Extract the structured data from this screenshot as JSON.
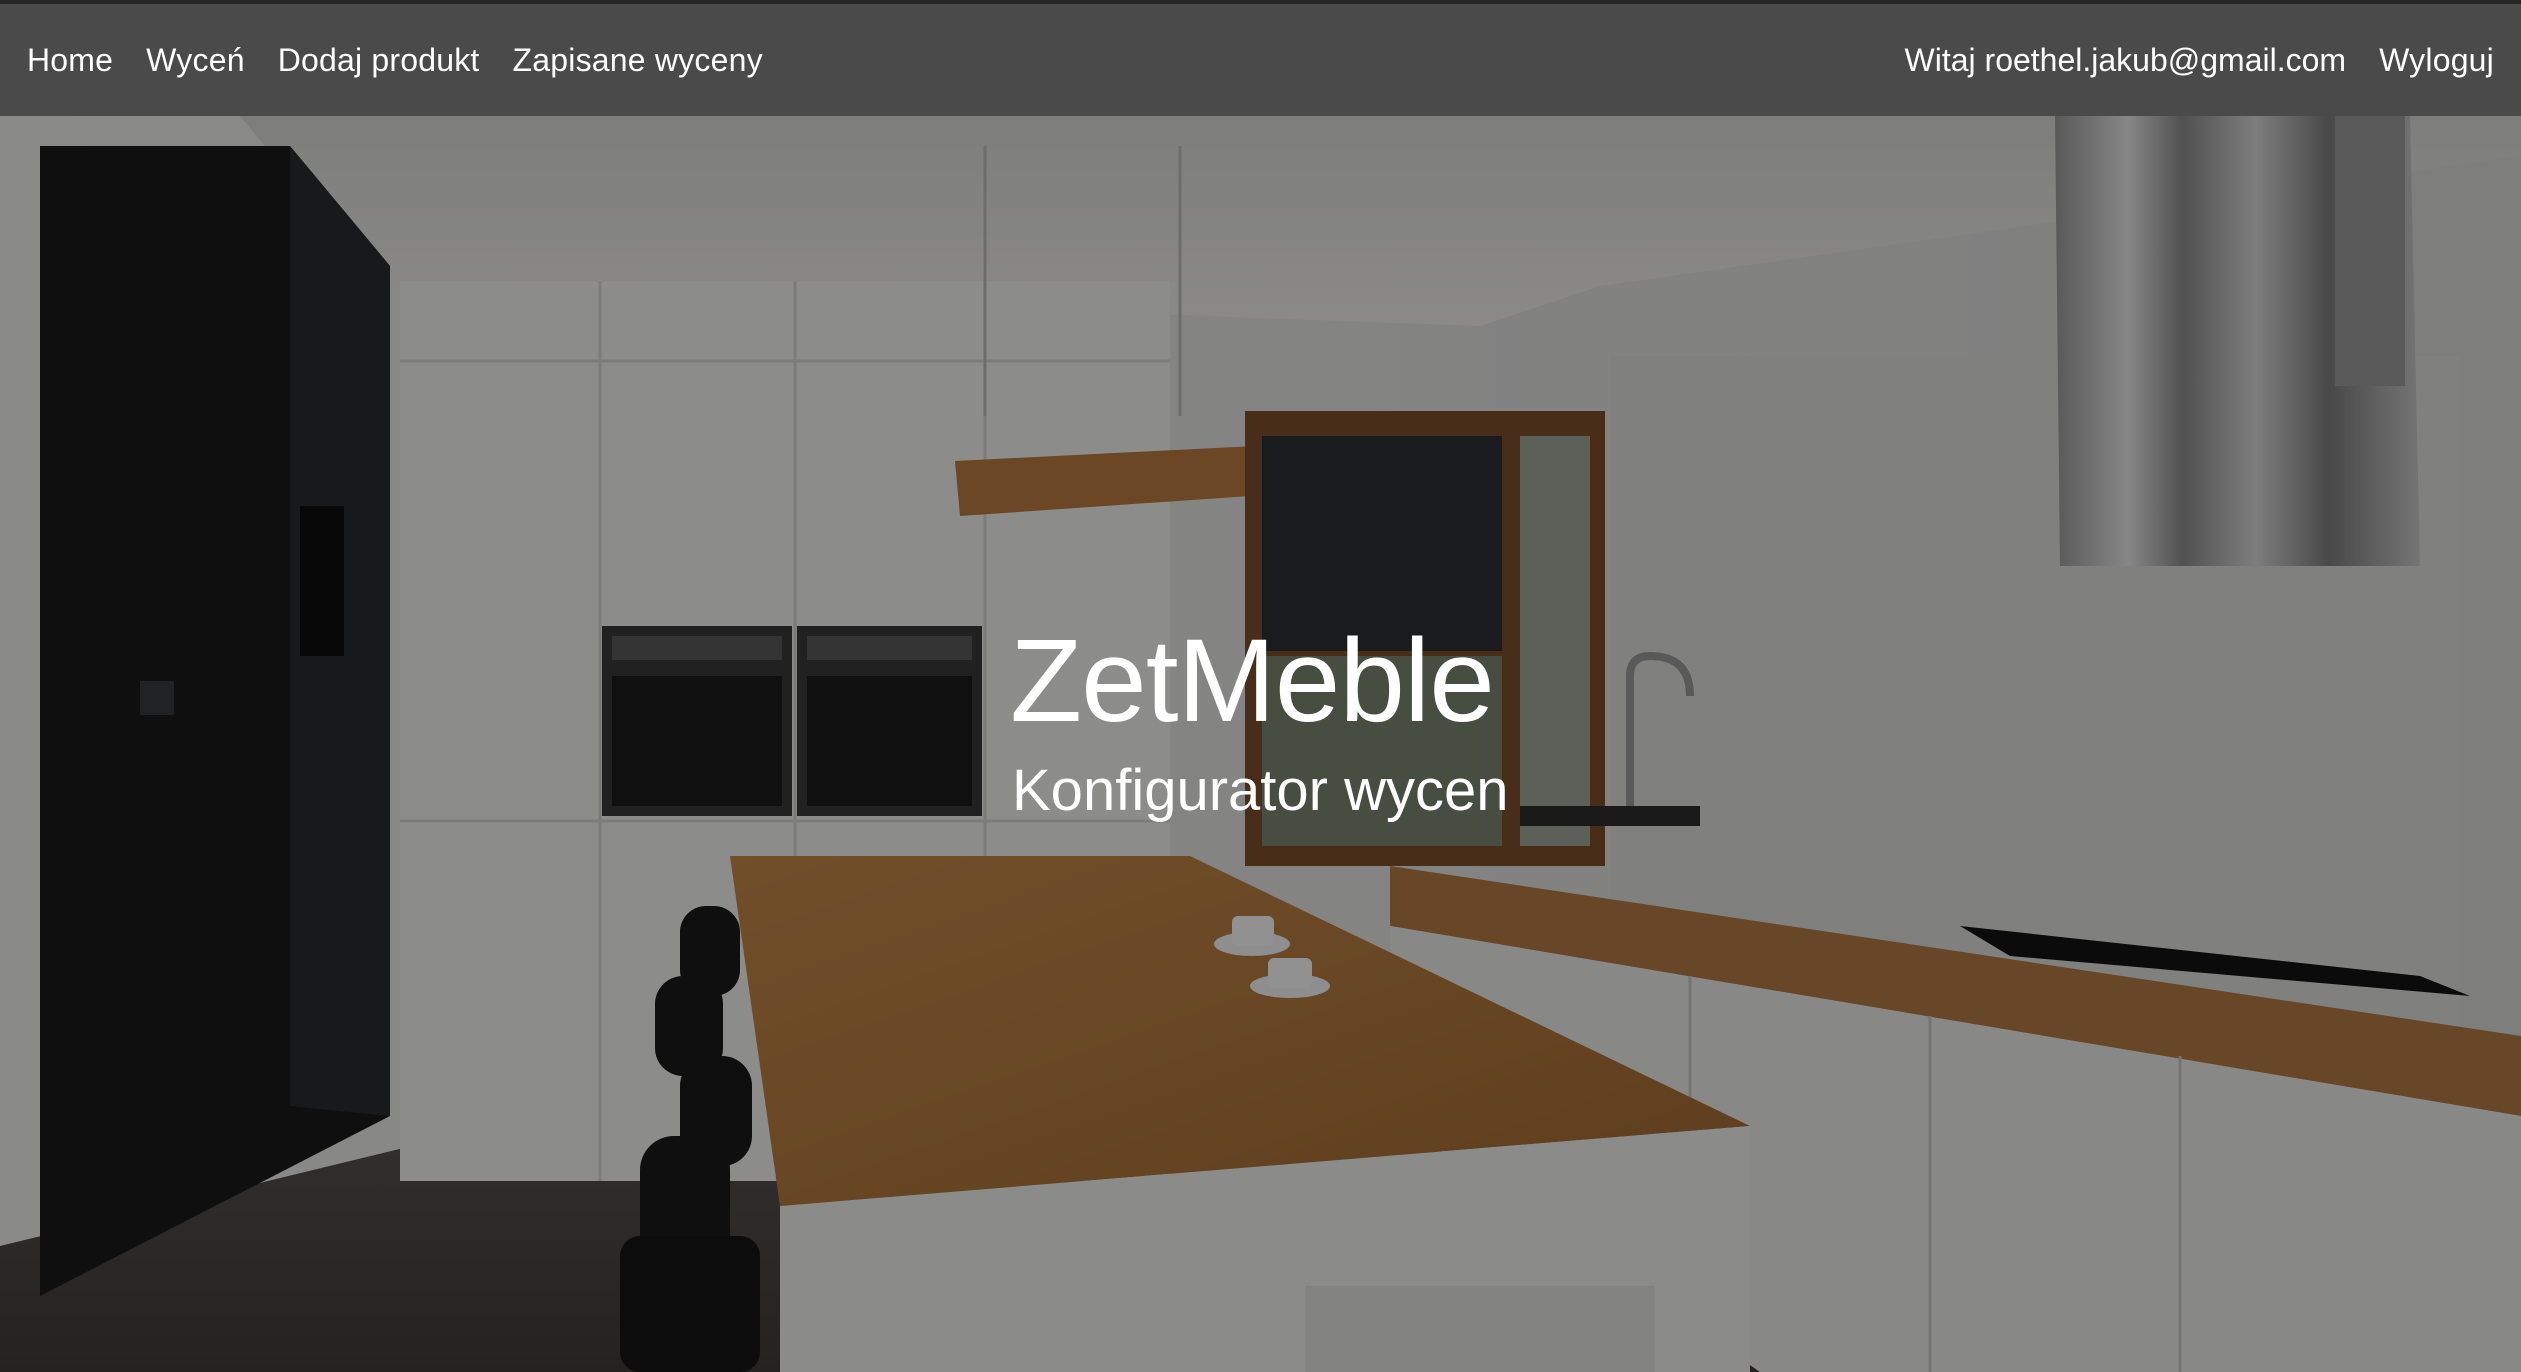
{
  "nav": {
    "links": [
      "Home",
      "Wyceń",
      "Dodaj produkt",
      "Zapisane wyceny"
    ],
    "greeting": "Witaj roethel.jakub@gmail.com",
    "logout": "Wyloguj"
  },
  "hero": {
    "title": "ZetMeble",
    "subtitle": "Konfigurator wycen",
    "background": "kitchen-photo"
  },
  "colors": {
    "navbar": "#4a4a4a",
    "overlay": "rgba(0,0,0,0.42)",
    "text": "#ffffff"
  }
}
